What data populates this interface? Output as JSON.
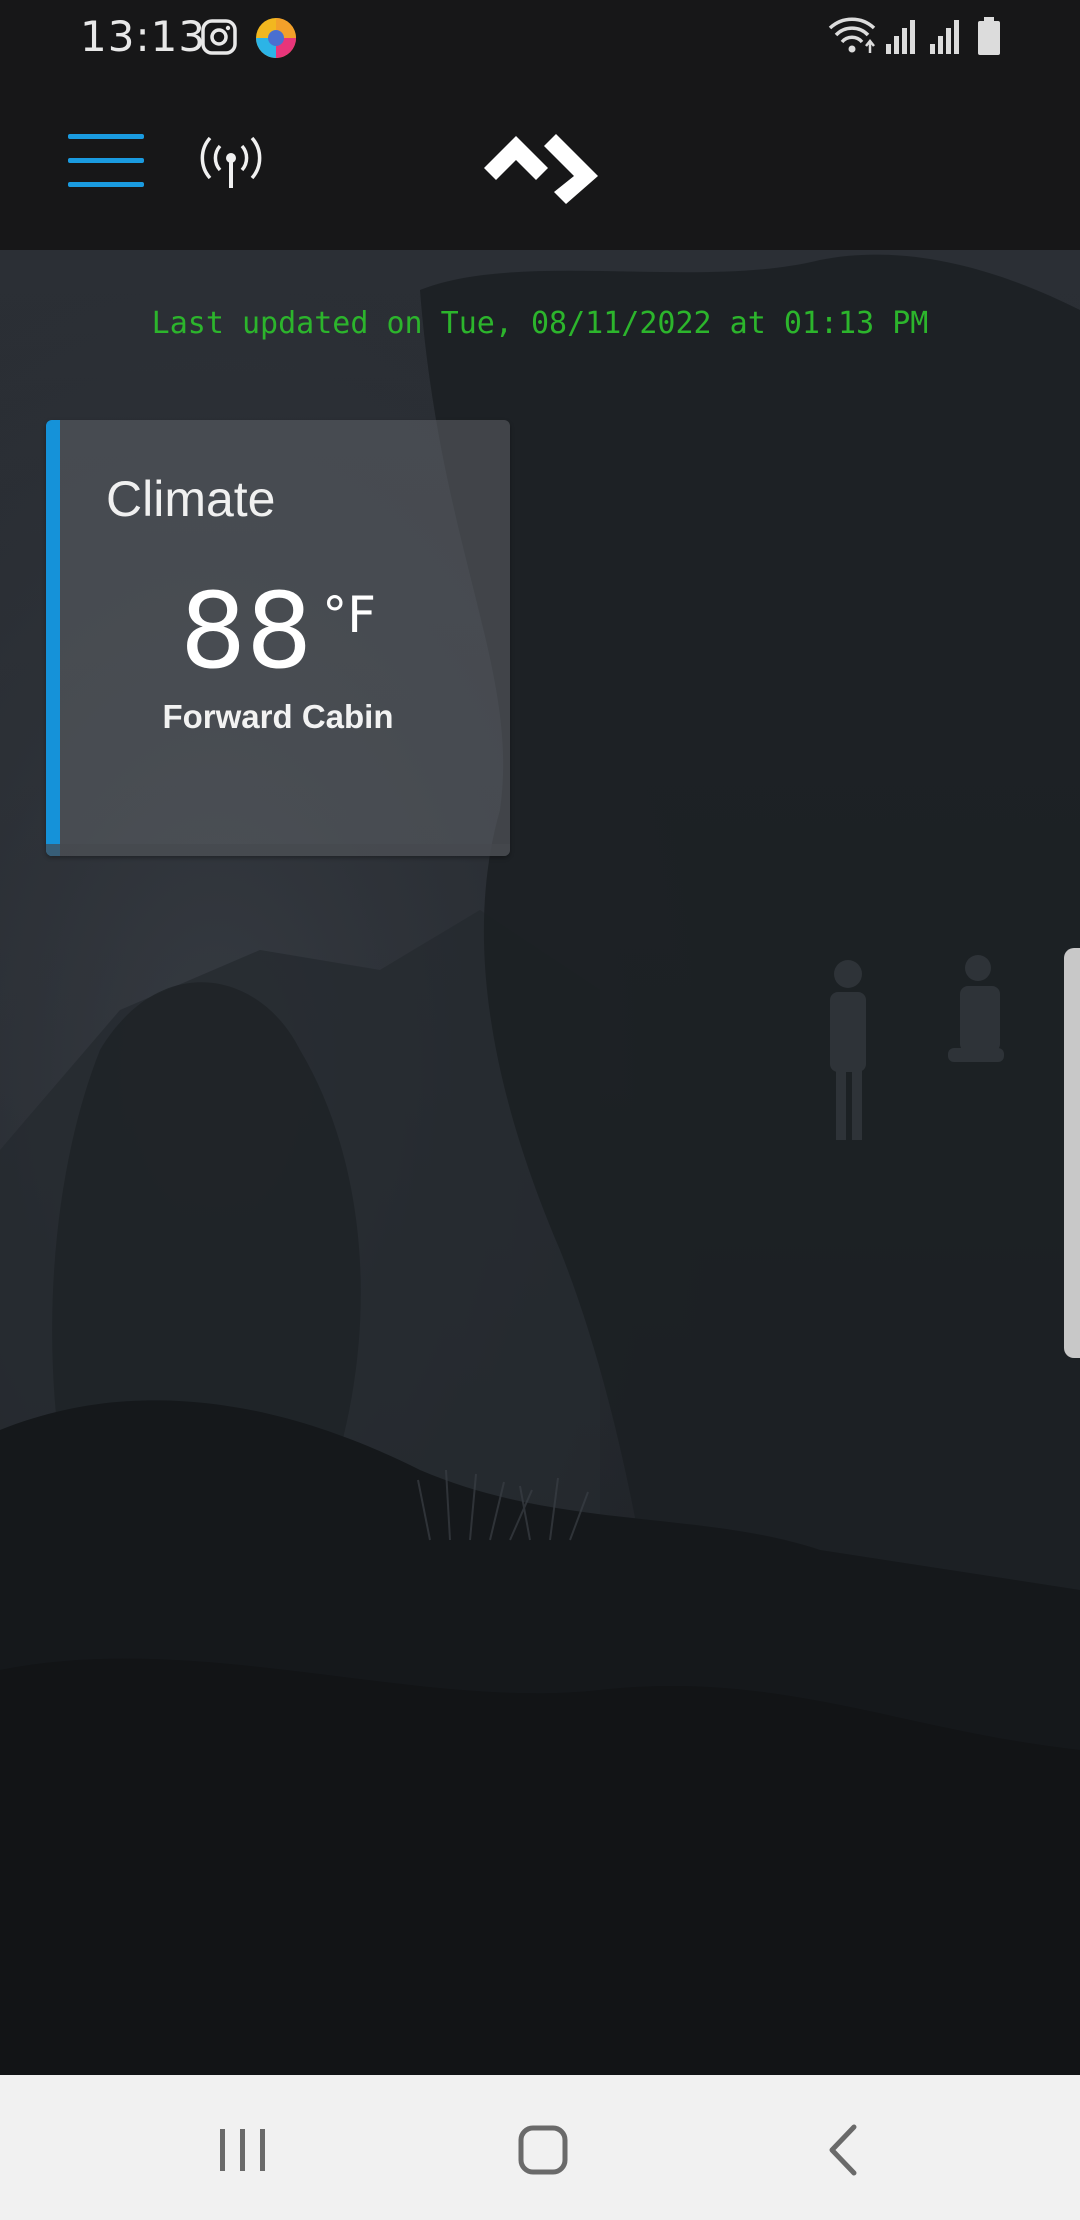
{
  "status_bar": {
    "time": "13:13",
    "left_icons": [
      "instagram-icon",
      "colorful-app-icon"
    ],
    "right_icons": [
      "wifi-icon",
      "cell-signal-icon",
      "cell-signal-icon",
      "battery-icon"
    ]
  },
  "app_bar": {
    "menu_icon": "hamburger-menu-icon",
    "signal_icon": "antenna-broadcast-icon",
    "logo_icon": "brand-logo-icon",
    "accent_color": "#1a9be0"
  },
  "main": {
    "last_updated": "Last updated on Tue, 08/11/2022 at 01:13 PM",
    "last_updated_color": "#2cb52c",
    "climate_card": {
      "title": "Climate",
      "temperature": "88",
      "unit": "°F",
      "location": "Forward Cabin",
      "accent_color": "#1592d9"
    }
  },
  "nav_bar": {
    "recent_icon": "recent-apps-icon",
    "home_icon": "home-icon",
    "back_icon": "back-icon"
  }
}
